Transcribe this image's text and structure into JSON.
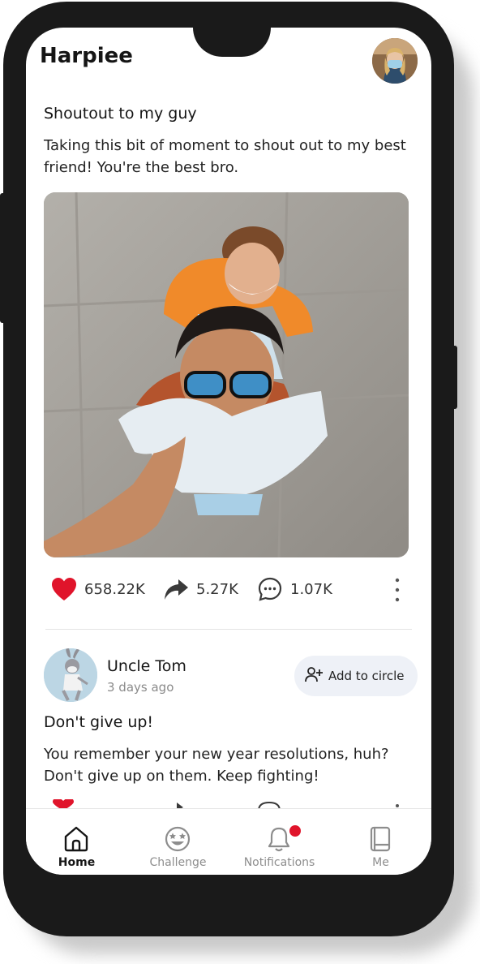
{
  "app": {
    "title": "Harpiee"
  },
  "post1": {
    "title": "Shoutout to my guy",
    "body": "Taking this bit of moment to shout out to my best friend! You're the best bro.",
    "likes": "658.22K",
    "shares": "5.27K",
    "comments": "1.07K"
  },
  "post2": {
    "author": "Uncle Tom",
    "time": "3 days ago",
    "add_label": "Add to circle",
    "title": "Don't give up!",
    "body": "You remember your new year resolutions, huh? Don't give up on them. Keep fighting!"
  },
  "tabs": [
    {
      "label": "Home",
      "icon": "home-icon",
      "active": true
    },
    {
      "label": "Challenge",
      "icon": "star-eyes-face-icon",
      "active": false
    },
    {
      "label": "Notifications",
      "icon": "bell-icon",
      "active": false
    },
    {
      "label": "Me",
      "icon": "notebook-icon",
      "active": false
    }
  ],
  "colors": {
    "like": "#e0142b",
    "active_tab": "#151515",
    "inactive_tab": "#8d8d8d",
    "add_circle_bg": "#eef1f7"
  }
}
